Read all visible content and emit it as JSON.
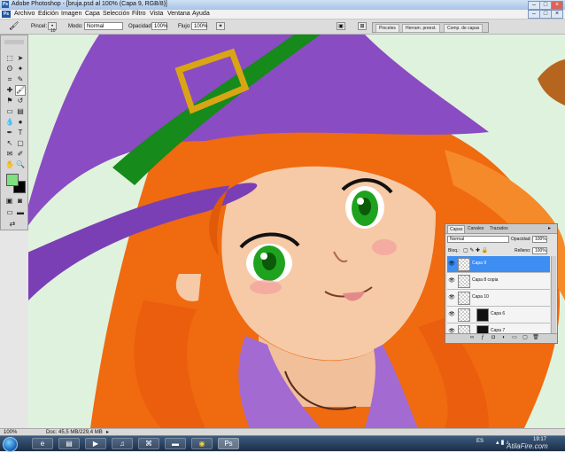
{
  "window": {
    "title": "Adobe Photoshop - [bruja.psd al 100% (Capa 9, RGB/8)]",
    "app_icon": "Ps"
  },
  "menu": {
    "items": [
      "Archivo",
      "Edición",
      "Imagen",
      "Capa",
      "Selección",
      "Filtro",
      "Vista",
      "Ventana",
      "Ayuda"
    ]
  },
  "options": {
    "pincel_label": "Pincel:",
    "pincel_size": "10",
    "modo_label": "Modo:",
    "modo_value": "Normal",
    "opacidad_label": "Opacidad:",
    "opacidad_value": "100%",
    "flujo_label": "Flujo:",
    "flujo_value": "100%",
    "well_tabs": [
      "Pinceles",
      "Herram. preest.",
      "Comp. de capas"
    ]
  },
  "layers_panel": {
    "tabs": [
      "Capas",
      "Canales",
      "Trazados"
    ],
    "blend_mode": "Normal",
    "opacity_label": "Opacidad:",
    "opacity_value": "100%",
    "lock_label": "Bloq.:",
    "fill_label": "Relleno:",
    "fill_value": "100%",
    "layers": [
      {
        "name": "Capa 9",
        "selected": true,
        "thumb": "transparent"
      },
      {
        "name": "Capa 8 copia",
        "selected": false,
        "thumb": "transparent"
      },
      {
        "name": "Capa 10",
        "selected": false,
        "thumb": "transparent"
      },
      {
        "name": "Capa 6",
        "selected": false,
        "thumb": "mask"
      },
      {
        "name": "Capa 7",
        "selected": false,
        "thumb": "mask"
      }
    ]
  },
  "status": {
    "zoom": "100%",
    "doc": "Doc: 45,5 MB/229,4 MB"
  },
  "taskbar": {
    "lang": "ES",
    "time": "19:17",
    "watermark": "AtilaFire.com"
  },
  "colors": {
    "foreground": "#7ee07e",
    "background": "#000000",
    "accent_selected": "#3d8df2"
  }
}
